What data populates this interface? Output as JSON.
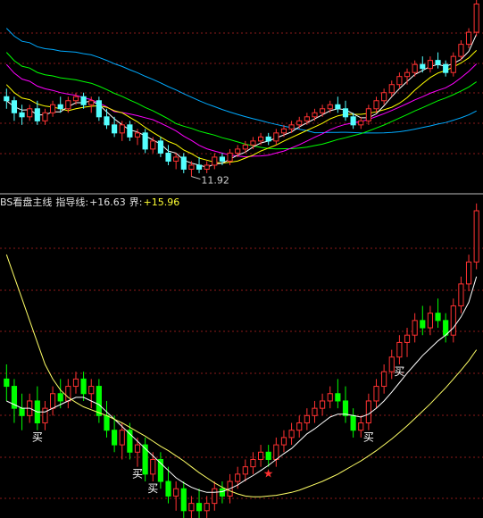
{
  "indicator_header": {
    "name": "BS看盘主线",
    "guide_label": "指导线:",
    "guide_value": "+16.63",
    "bound_label": "界:",
    "bound_value": "+15.96"
  },
  "colors": {
    "background": "#000000",
    "grid": "#8b1a1a",
    "up": "#ff3232",
    "down_top": "#54ffff",
    "down_bottom": "#00ff00",
    "ma5": "#ffffff",
    "ma10": "#ffff00",
    "ma20": "#ff00ff",
    "ma30": "#00ff00",
    "ma60": "#00aaff",
    "guide_line": "#ffffff",
    "bound_line": "#ffff66",
    "buy_text": "#ffffff",
    "star": "#ff3030"
  },
  "chart_data": [
    {
      "type": "candlestick",
      "panel": "price",
      "low_annotation": "11.92",
      "low_value": 11.92,
      "moving_averages": [
        "ma5",
        "ma10",
        "ma20",
        "ma30",
        "ma60"
      ],
      "ohlc": [
        [
          13.9,
          14.1,
          13.6,
          13.8
        ],
        [
          13.8,
          13.9,
          13.3,
          13.5
        ],
        [
          13.5,
          13.7,
          13.2,
          13.4
        ],
        [
          13.4,
          13.7,
          13.3,
          13.6
        ],
        [
          13.6,
          13.8,
          13.2,
          13.3
        ],
        [
          13.3,
          13.6,
          13.2,
          13.5
        ],
        [
          13.5,
          13.8,
          13.4,
          13.7
        ],
        [
          13.7,
          13.9,
          13.5,
          13.6
        ],
        [
          13.6,
          13.9,
          13.5,
          13.8
        ],
        [
          13.8,
          14.0,
          13.7,
          13.9
        ],
        [
          13.9,
          14.0,
          13.6,
          13.7
        ],
        [
          13.7,
          13.9,
          13.5,
          13.8
        ],
        [
          13.8,
          13.9,
          13.3,
          13.4
        ],
        [
          13.4,
          13.6,
          13.1,
          13.2
        ],
        [
          13.2,
          13.4,
          12.9,
          13.0
        ],
        [
          13.0,
          13.3,
          12.8,
          13.2
        ],
        [
          13.2,
          13.3,
          12.8,
          12.9
        ],
        [
          12.9,
          13.1,
          12.7,
          13.0
        ],
        [
          13.0,
          13.1,
          12.5,
          12.6
        ],
        [
          12.6,
          12.9,
          12.5,
          12.8
        ],
        [
          12.8,
          12.9,
          12.4,
          12.5
        ],
        [
          12.5,
          12.7,
          12.2,
          12.3
        ],
        [
          12.3,
          12.5,
          12.1,
          12.4
        ],
        [
          12.4,
          12.5,
          12.0,
          12.1
        ],
        [
          12.1,
          12.3,
          11.92,
          12.2
        ],
        [
          12.2,
          12.4,
          12.0,
          12.1
        ],
        [
          12.1,
          12.3,
          12.0,
          12.2
        ],
        [
          12.2,
          12.5,
          12.1,
          12.4
        ],
        [
          12.4,
          12.5,
          12.2,
          12.3
        ],
        [
          12.3,
          12.6,
          12.2,
          12.5
        ],
        [
          12.5,
          12.7,
          12.4,
          12.6
        ],
        [
          12.6,
          12.8,
          12.5,
          12.7
        ],
        [
          12.7,
          12.9,
          12.6,
          12.8
        ],
        [
          12.8,
          13.0,
          12.7,
          12.9
        ],
        [
          12.9,
          13.0,
          12.7,
          12.8
        ],
        [
          12.8,
          13.1,
          12.7,
          13.0
        ],
        [
          13.0,
          13.2,
          12.9,
          13.1
        ],
        [
          13.1,
          13.3,
          13.0,
          13.2
        ],
        [
          13.2,
          13.4,
          13.1,
          13.3
        ],
        [
          13.3,
          13.5,
          13.2,
          13.4
        ],
        [
          13.4,
          13.6,
          13.3,
          13.5
        ],
        [
          13.5,
          13.7,
          13.4,
          13.6
        ],
        [
          13.6,
          13.8,
          13.5,
          13.7
        ],
        [
          13.7,
          13.9,
          13.5,
          13.6
        ],
        [
          13.6,
          13.8,
          13.3,
          13.4
        ],
        [
          13.4,
          13.5,
          13.1,
          13.2
        ],
        [
          13.2,
          13.4,
          13.1,
          13.3
        ],
        [
          13.3,
          13.7,
          13.2,
          13.6
        ],
        [
          13.6,
          13.9,
          13.5,
          13.8
        ],
        [
          13.8,
          14.1,
          13.7,
          14.0
        ],
        [
          14.0,
          14.3,
          13.9,
          14.2
        ],
        [
          14.2,
          14.5,
          14.1,
          14.4
        ],
        [
          14.4,
          14.6,
          14.2,
          14.5
        ],
        [
          14.5,
          14.8,
          14.4,
          14.7
        ],
        [
          14.7,
          14.9,
          14.5,
          14.6
        ],
        [
          14.6,
          14.9,
          14.5,
          14.8
        ],
        [
          14.8,
          15.0,
          14.6,
          14.7
        ],
        [
          14.7,
          14.8,
          14.4,
          14.5
        ],
        [
          14.5,
          15.0,
          14.4,
          14.9
        ],
        [
          14.9,
          15.3,
          14.8,
          15.2
        ],
        [
          15.2,
          15.6,
          15.1,
          15.5
        ],
        [
          15.5,
          16.3,
          15.4,
          16.2
        ]
      ]
    },
    {
      "type": "line",
      "panel": "indicator",
      "series": [
        {
          "name": "指导线",
          "color": "#ffffff",
          "values": [
            13.6,
            13.55,
            13.5,
            13.5,
            13.45,
            13.45,
            13.5,
            13.55,
            13.6,
            13.65,
            13.65,
            13.6,
            13.55,
            13.45,
            13.35,
            13.25,
            13.15,
            13.05,
            12.95,
            12.85,
            12.75,
            12.65,
            12.55,
            12.48,
            12.42,
            12.38,
            12.35,
            12.35,
            12.36,
            12.4,
            12.45,
            12.52,
            12.58,
            12.65,
            12.72,
            12.8,
            12.88,
            12.95,
            13.05,
            13.15,
            13.22,
            13.3,
            13.38,
            13.42,
            13.42,
            13.4,
            13.38,
            13.42,
            13.5,
            13.6,
            13.72,
            13.85,
            13.98,
            14.1,
            14.22,
            14.32,
            14.42,
            14.5,
            14.6,
            14.75,
            14.95,
            15.3
          ]
        },
        {
          "name": "界",
          "color": "#ffff66",
          "values": [
            15.6,
            15.3,
            15.0,
            14.7,
            14.4,
            14.1,
            13.9,
            13.75,
            13.65,
            13.58,
            13.52,
            13.48,
            13.44,
            13.4,
            13.35,
            13.3,
            13.24,
            13.18,
            13.12,
            13.05,
            12.98,
            12.92,
            12.85,
            12.78,
            12.7,
            12.62,
            12.55,
            12.48,
            12.42,
            12.37,
            12.33,
            12.3,
            12.29,
            12.29,
            12.3,
            12.31,
            12.33,
            12.35,
            12.38,
            12.42,
            12.46,
            12.5,
            12.55,
            12.6,
            12.66,
            12.72,
            12.78,
            12.85,
            12.92,
            13.0,
            13.08,
            13.17,
            13.26,
            13.36,
            13.46,
            13.56,
            13.67,
            13.78,
            13.9,
            14.02,
            14.15,
            14.3
          ]
        }
      ],
      "signals": [
        {
          "index": 4,
          "label": "买"
        },
        {
          "index": 17,
          "label": "买"
        },
        {
          "index": 19,
          "label": "买"
        },
        {
          "index": 25,
          "label": "买"
        },
        {
          "index": 47,
          "label": "买"
        },
        {
          "index": 51,
          "label": "买"
        },
        {
          "index": 34,
          "label": "★"
        }
      ]
    }
  ]
}
